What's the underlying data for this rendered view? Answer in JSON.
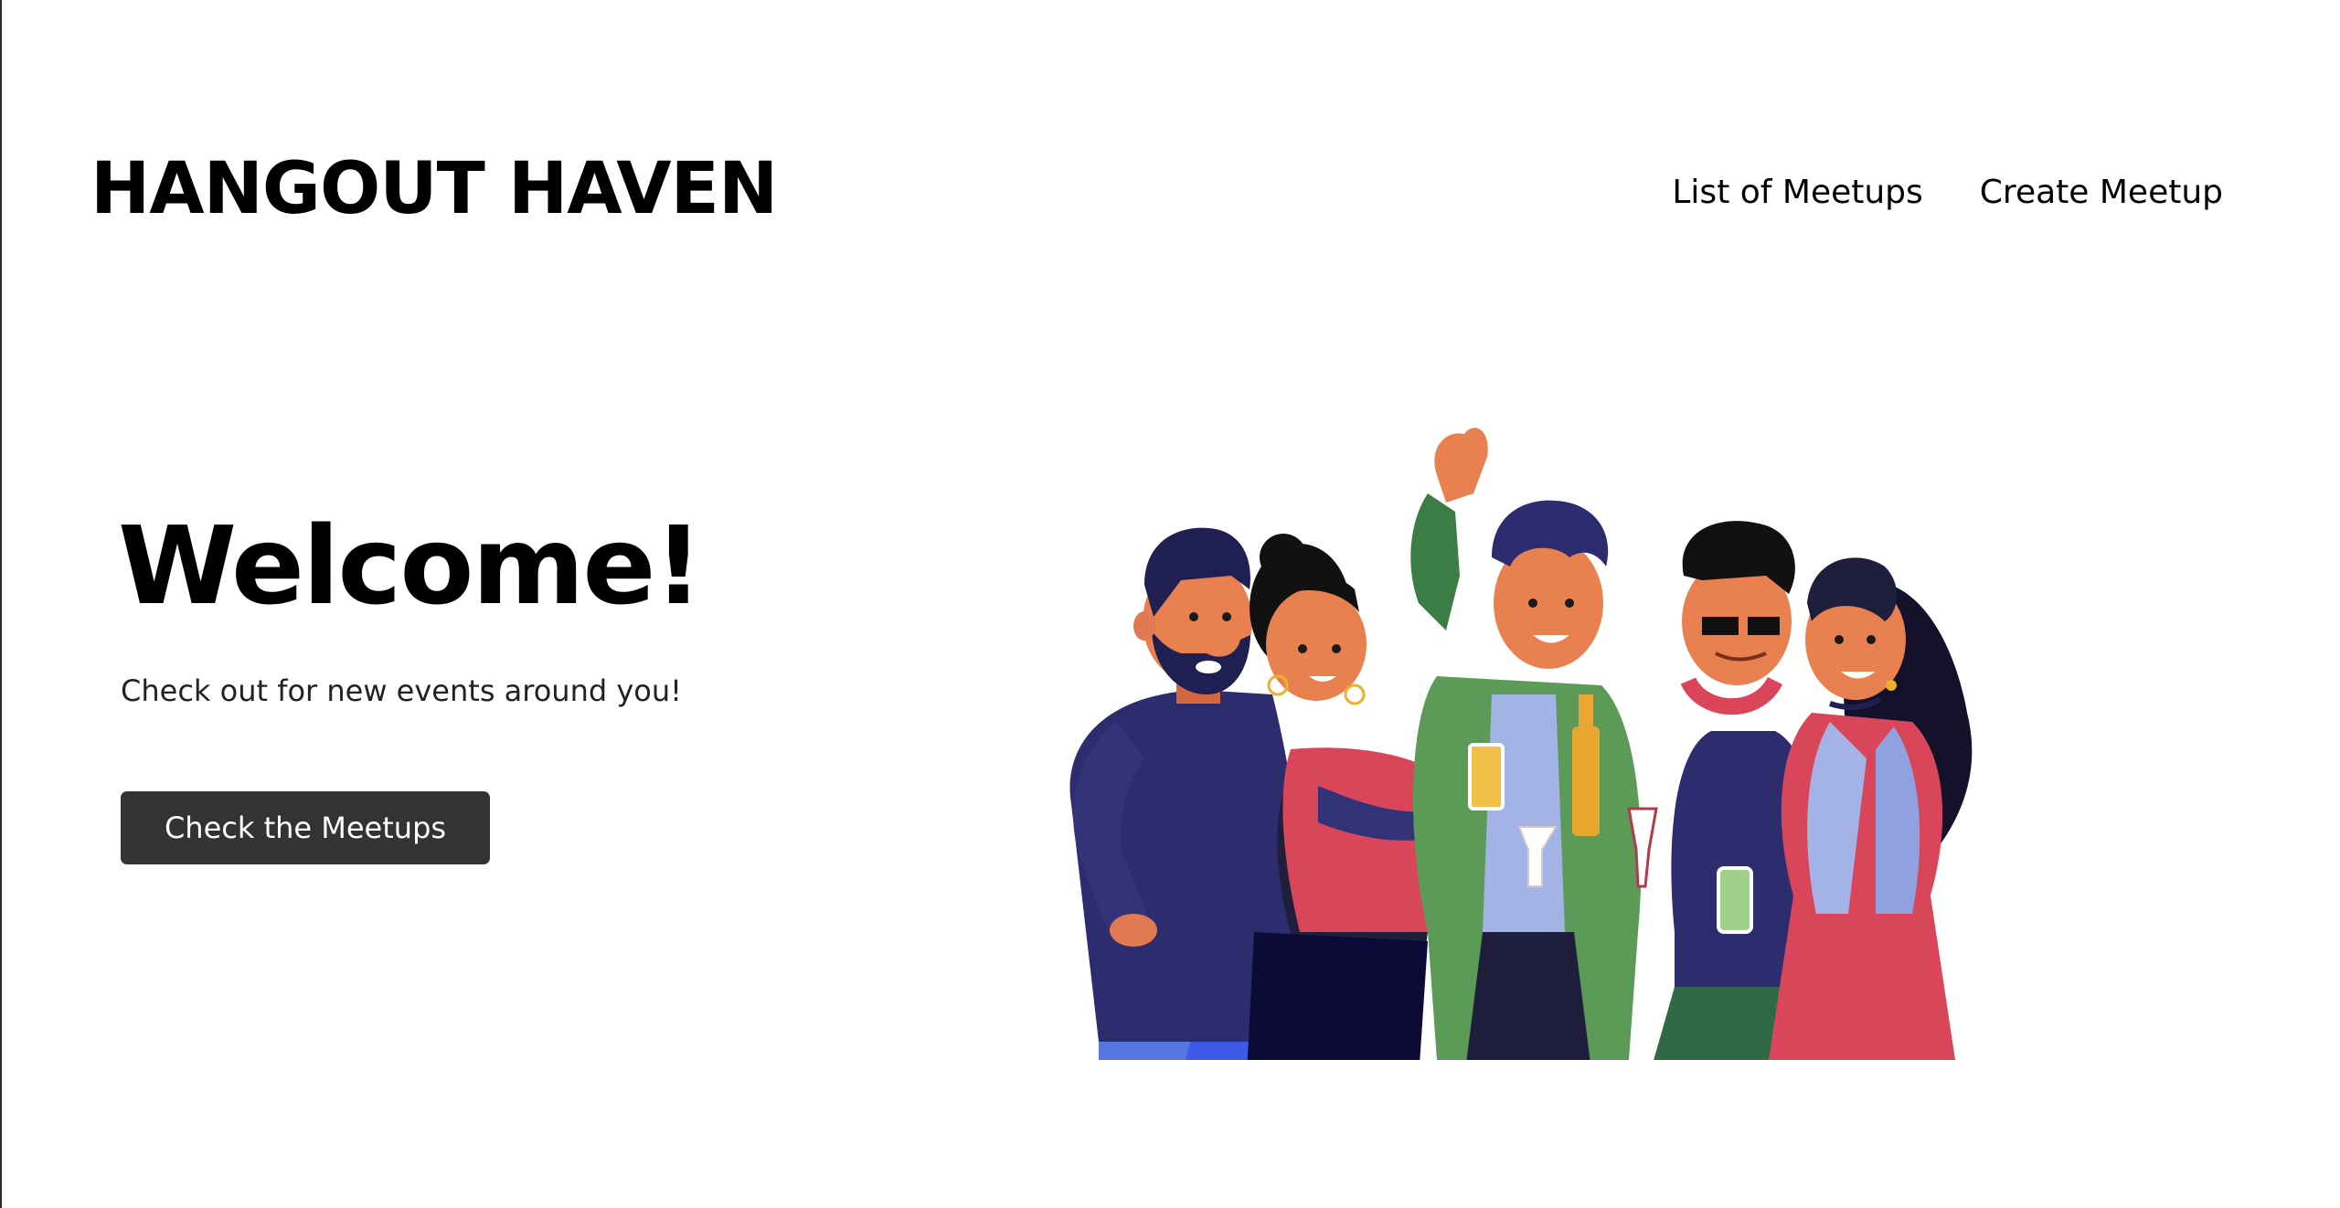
{
  "header": {
    "brand": "HANGOUT HAVEN",
    "nav": {
      "list_label": "List of Meetups",
      "create_label": "Create Meetup"
    }
  },
  "hero": {
    "title": "Welcome!",
    "subtitle": "Check out for new events around you!",
    "cta_label": "Check the Meetups"
  },
  "colors": {
    "button_bg": "#333333",
    "text": "#000000"
  }
}
